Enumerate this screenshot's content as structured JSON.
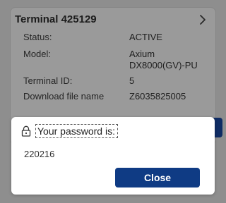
{
  "terminal": {
    "title": "Terminal 425129",
    "rows": [
      {
        "label": "Status:",
        "value": "ACTIVE"
      },
      {
        "label": "Model:",
        "value": "Axium DX8000(GV)-PU"
      },
      {
        "label": "Terminal ID:",
        "value": "5"
      },
      {
        "label": "Download file name",
        "value": "Z6035825005"
      }
    ]
  },
  "dialog": {
    "title": "Your password is:",
    "password": "220216",
    "close_label": "Close"
  },
  "colors": {
    "primary": "#0f3b84",
    "overlay": "#8e8e8e"
  },
  "icons": {
    "chevron": "chevron-right-icon",
    "lock": "lock-icon"
  }
}
